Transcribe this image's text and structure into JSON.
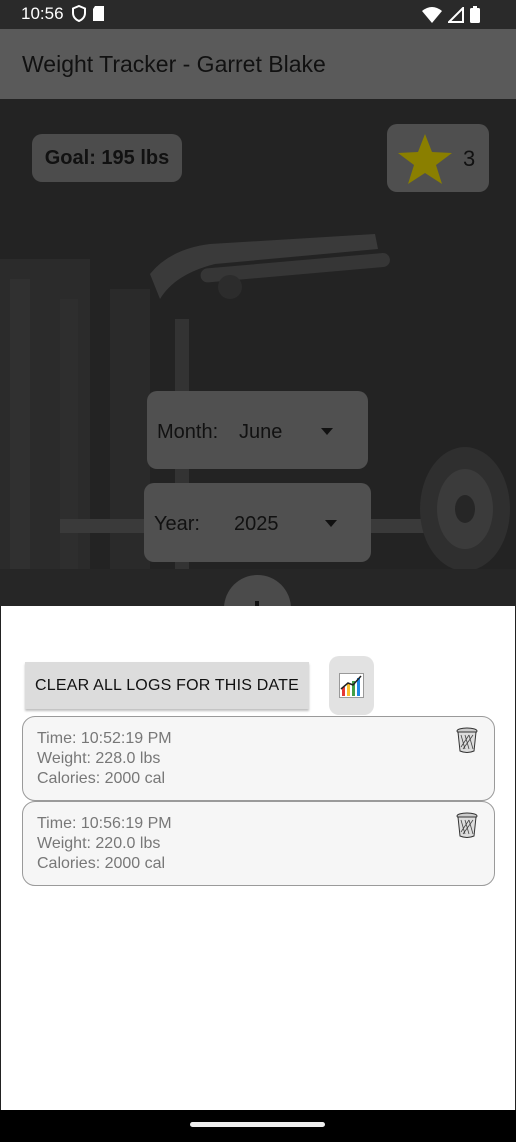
{
  "status_bar": {
    "time": "10:56"
  },
  "app_bar": {
    "title": "Weight Tracker - Garret Blake"
  },
  "goal": {
    "label": "Goal: 195 lbs"
  },
  "stars": {
    "count": "3"
  },
  "month_picker": {
    "label": "Month:",
    "value": "June"
  },
  "year_picker": {
    "label": "Year:",
    "value": "2025"
  },
  "actions": {
    "clear_label": "Clear all logs for this date"
  },
  "logs": [
    {
      "time": "Time: 10:52:19 PM",
      "weight": "Weight: 228.0 lbs",
      "calories": "Calories: 2000 cal"
    },
    {
      "time": "Time: 10:56:19 PM",
      "weight": "Weight: 220.0 lbs",
      "calories": "Calories: 2000 cal"
    }
  ],
  "colors": {
    "star": "#8a7f00",
    "appbar": "#5a5a5a",
    "sheet": "#ffffff"
  }
}
